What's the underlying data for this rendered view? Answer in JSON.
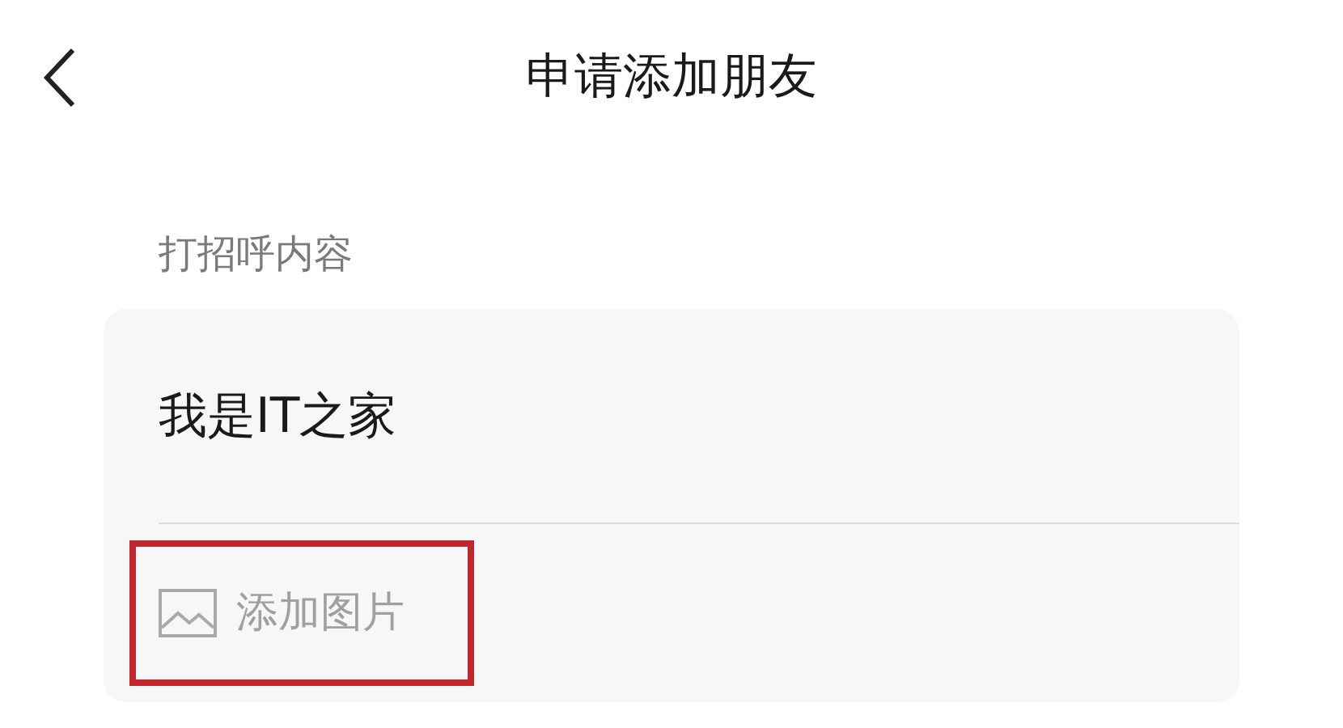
{
  "header": {
    "title": "申请添加朋友"
  },
  "greeting": {
    "label": "打招呼内容",
    "value": "我是IT之家"
  },
  "attachment": {
    "label": "添加图片",
    "highlighted": true
  }
}
